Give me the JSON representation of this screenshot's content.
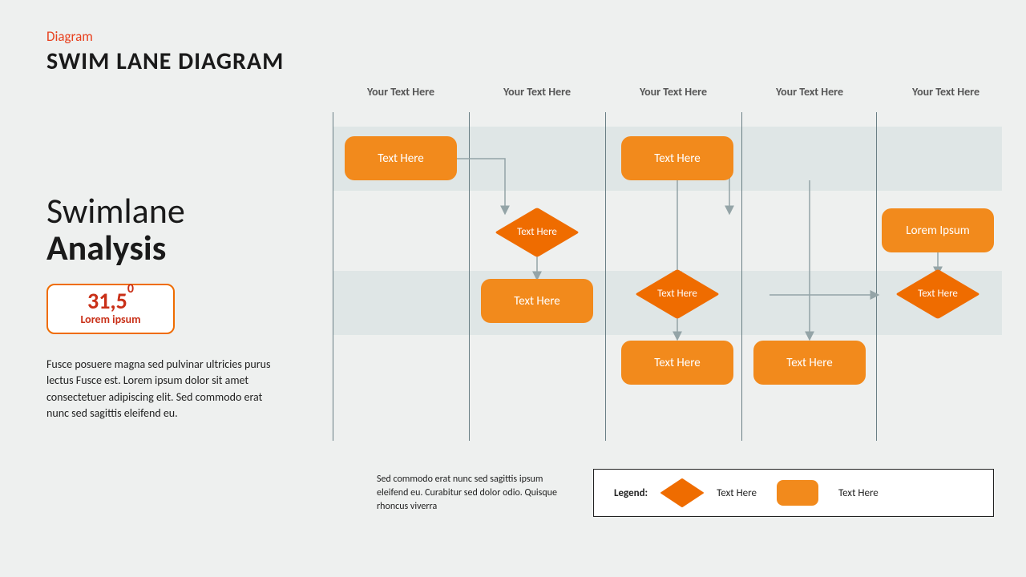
{
  "category": "Diagram",
  "title": "SWIM LANE DIAGRAM",
  "analysis": {
    "line1": "Swimlane",
    "line2": "Analysis"
  },
  "metric": {
    "value": "31,5",
    "sup": "0",
    "label": "Lorem ipsum"
  },
  "body": "Fusce posuere magna sed pulvinar ultricies purus lectus Fusce est. Lorem ipsum dolor sit amet consectetuer adipiscing elit. Sed commodo erat nunc sed sagittis eleifend eu.",
  "columns": [
    "Your Text Here",
    "Your Text Here",
    "Your Text Here",
    "Your Text Here",
    "Your Text Here"
  ],
  "nodes": {
    "r1": "Text Here",
    "r2": "Text Here",
    "r3": "Text Here",
    "r4": "Text Here",
    "r5": "Text Here",
    "r6": "Lorem Ipsum",
    "d1": "Text\nHere",
    "d2": "Text\nHere",
    "d3": "Text\nHere"
  },
  "footnote": "Sed commodo erat nunc sed sagittis ipsum eleifend eu. Curabitur sed dolor odio. Quisque rhoncus viverra",
  "legend": {
    "title": "Legend:",
    "a": "Text Here",
    "b": "Text Here"
  }
}
